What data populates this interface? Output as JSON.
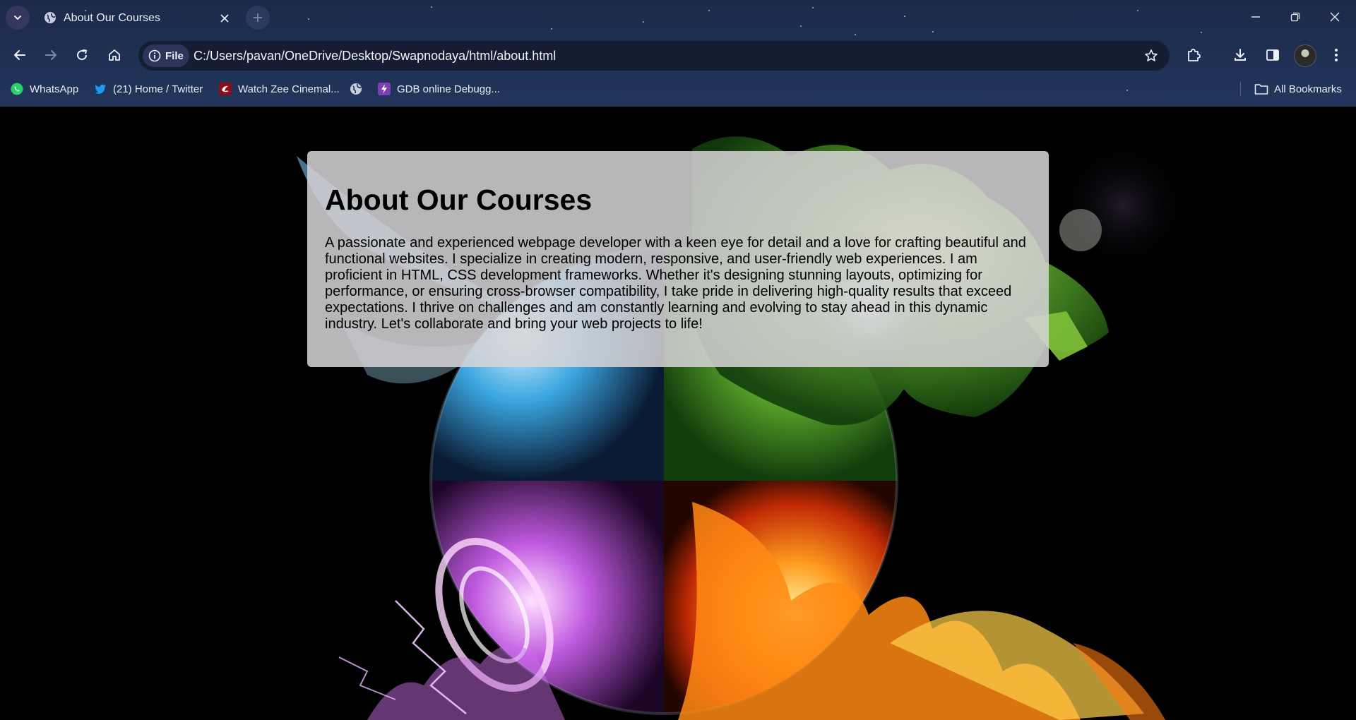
{
  "browser": {
    "tab": {
      "title": "About Our Courses"
    },
    "address_bar": {
      "scheme_chip": "File",
      "url": "C:/Users/pavan/OneDrive/Desktop/Swapnodaya/html/about.html"
    },
    "bookmarks": [
      {
        "label": "WhatsApp",
        "icon": "whatsapp-icon"
      },
      {
        "label": "(21) Home / Twitter",
        "icon": "twitter-icon"
      },
      {
        "label": "Watch Zee Cinemal...",
        "icon": "zee-icon"
      },
      {
        "label": "",
        "icon": "globe-icon"
      },
      {
        "label": "GDB online Debugg...",
        "icon": "gdb-icon"
      }
    ],
    "all_bookmarks_label": "All Bookmarks"
  },
  "page": {
    "heading": "About Our Courses",
    "body": "A passionate and experienced webpage developer with a keen eye for detail and a love for crafting beautiful and functional websites. I specialize in creating modern, responsive, and user-friendly web experiences. I am proficient in HTML, CSS development frameworks. Whether it's designing stunning layouts, optimizing for performance, or ensuring cross-browser compatibility, I take pride in delivering high-quality results that exceed expectations. I thrive on challenges and am constantly learning and evolving to stay ahead in this dynamic industry. Let's collaborate and bring your web projects to life!"
  },
  "colors": {
    "chrome_bg": "#1f2f52",
    "omnibox_bg": "#151d33",
    "card_bg": "#d6d4d6"
  }
}
